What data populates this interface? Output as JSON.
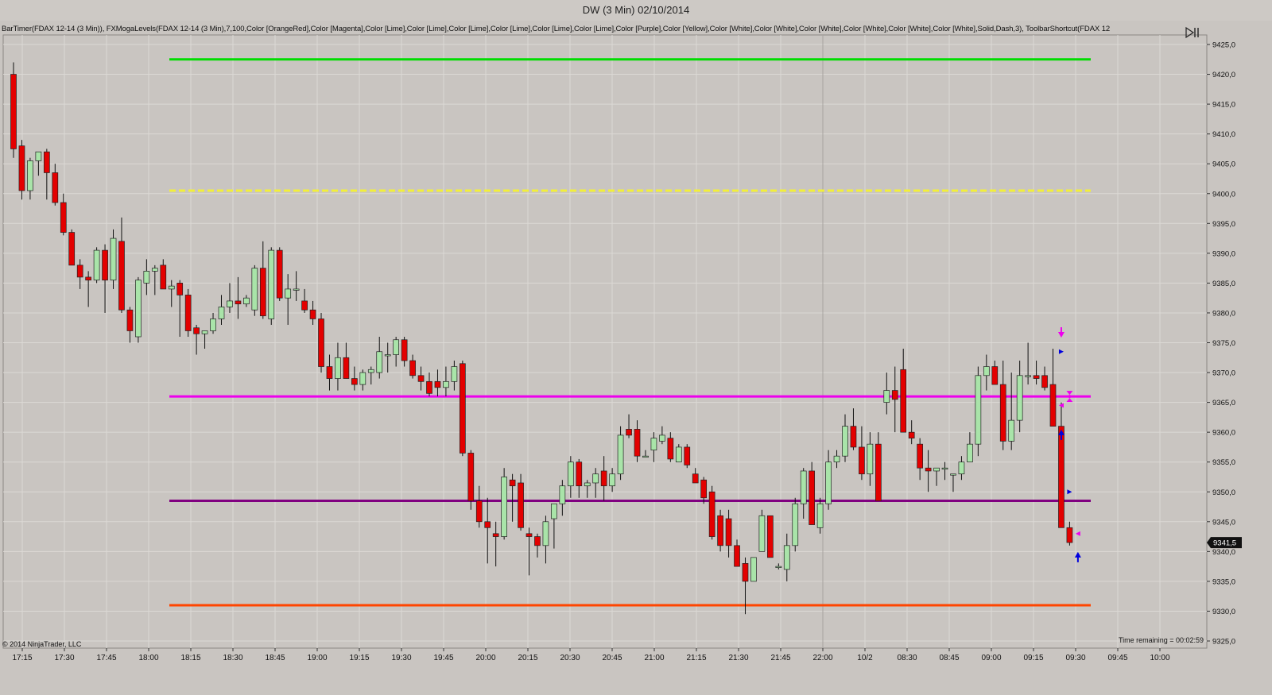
{
  "window": {
    "title": "DW (3 Min)  02/10/2014"
  },
  "indicator_text": "BarTimer(FDAX 12-14 (3 Min)), FXMogaLevels(FDAX 12-14 (3 Min),7,100,Color [OrangeRed],Color [Magenta],Color [Lime],Color [Lime],Color [Lime],Color [Lime],Color [Lime],Color [Lime],Color [Purple],Color [Yellow],Color [White],Color [White],Color [White],Color [White],Color [White],Color [White],Solid,Dash,3), ToolbarShortcut(FDAX 12",
  "copyright": "© 2014 NinjaTrader, LLC",
  "time_remaining": "Time remaining = 00:02:59",
  "colors": {
    "background": "#c9c5c1",
    "grid": "#dcd9d5",
    "up_candle": "#a9e4a9",
    "down_candle": "#e30000",
    "wick": "#111111"
  },
  "chart_data": {
    "type": "candlestick",
    "title": "DW (3 Min)  02/10/2014",
    "ylim": [
      9325,
      9428
    ],
    "grid": true,
    "y_ticks": [
      "9425,0",
      "9420,0",
      "9415,0",
      "9410,0",
      "9405,0",
      "9400,0",
      "9395,0",
      "9390,0",
      "9385,0",
      "9380,0",
      "9375,0",
      "9370,0",
      "9365,0",
      "9360,0",
      "9355,0",
      "9350,0",
      "9345,0",
      "9340,0",
      "9335,0",
      "9330,0",
      "9325,0"
    ],
    "x_ticks": [
      "17:15",
      "17:30",
      "17:45",
      "18:00",
      "18:15",
      "18:30",
      "18:45",
      "19:00",
      "19:15",
      "19:30",
      "19:45",
      "20:00",
      "20:15",
      "20:30",
      "20:45",
      "21:00",
      "21:15",
      "21:30",
      "21:45",
      "22:00",
      "10/2",
      "08:30",
      "08:45",
      "09:00",
      "09:15",
      "09:30",
      "09:45",
      "10:00"
    ],
    "last_price": "9341,5",
    "levels": [
      {
        "name": "lime-level",
        "value": 9422.5,
        "color": "#00dd00",
        "style": "solid"
      },
      {
        "name": "yellow-level",
        "value": 9400.5,
        "color": "#f2ef3a",
        "style": "dash"
      },
      {
        "name": "magenta-level",
        "value": 9366.0,
        "color": "#ee00ee",
        "style": "solid"
      },
      {
        "name": "purple-level",
        "value": 9348.5,
        "color": "#800080",
        "style": "solid"
      },
      {
        "name": "orangered-level",
        "value": 9331.0,
        "color": "#ff4500",
        "style": "solid"
      }
    ],
    "candles": [
      {
        "o": 9420,
        "h": 9422,
        "l": 9406,
        "c": 9407.5
      },
      {
        "o": 9408,
        "h": 9409,
        "l": 9399,
        "c": 9400.5
      },
      {
        "o": 9400.5,
        "h": 9406,
        "l": 9399,
        "c": 9405.5
      },
      {
        "o": 9405.5,
        "h": 9407,
        "l": 9403,
        "c": 9407
      },
      {
        "o": 9407,
        "h": 9407.5,
        "l": 9399,
        "c": 9403.5
      },
      {
        "o": 9403.5,
        "h": 9405,
        "l": 9398,
        "c": 9398.5
      },
      {
        "o": 9398.5,
        "h": 9400,
        "l": 9393,
        "c": 9393.5
      },
      {
        "o": 9393.5,
        "h": 9394,
        "l": 9388,
        "c": 9388
      },
      {
        "o": 9388,
        "h": 9389,
        "l": 9384,
        "c": 9386
      },
      {
        "o": 9386,
        "h": 9387,
        "l": 9381,
        "c": 9385.5
      },
      {
        "o": 9385.5,
        "h": 9391,
        "l": 9385,
        "c": 9390.5
      },
      {
        "o": 9390.5,
        "h": 9391.5,
        "l": 9380,
        "c": 9385.5
      },
      {
        "o": 9385.5,
        "h": 9394,
        "l": 9384,
        "c": 9392.5
      },
      {
        "o": 9392,
        "h": 9396,
        "l": 9380,
        "c": 9380.5
      },
      {
        "o": 9380.5,
        "h": 9381,
        "l": 9375,
        "c": 9377
      },
      {
        "o": 9376,
        "h": 9386,
        "l": 9375,
        "c": 9385.5
      },
      {
        "o": 9385,
        "h": 9389,
        "l": 9383,
        "c": 9387
      },
      {
        "o": 9387,
        "h": 9388,
        "l": 9383,
        "c": 9387.5
      },
      {
        "o": 9388,
        "h": 9389,
        "l": 9384,
        "c": 9384
      },
      {
        "o": 9384,
        "h": 9385.5,
        "l": 9381,
        "c": 9384.5
      },
      {
        "o": 9385,
        "h": 9385.5,
        "l": 9376,
        "c": 9383
      },
      {
        "o": 9383,
        "h": 9384,
        "l": 9376,
        "c": 9377
      },
      {
        "o": 9377.5,
        "h": 9378,
        "l": 9373,
        "c": 9376.5
      },
      {
        "o": 9376.5,
        "h": 9377,
        "l": 9374,
        "c": 9377
      },
      {
        "o": 9377,
        "h": 9380,
        "l": 9376.5,
        "c": 9379
      },
      {
        "o": 9379,
        "h": 9383,
        "l": 9378,
        "c": 9381
      },
      {
        "o": 9381,
        "h": 9385,
        "l": 9380,
        "c": 9382
      },
      {
        "o": 9382,
        "h": 9386,
        "l": 9379,
        "c": 9381.5
      },
      {
        "o": 9381.5,
        "h": 9383,
        "l": 9381,
        "c": 9382.5
      },
      {
        "o": 9380.5,
        "h": 9388,
        "l": 9379.5,
        "c": 9387.5
      },
      {
        "o": 9387.5,
        "h": 9392,
        "l": 9379,
        "c": 9379.5
      },
      {
        "o": 9379,
        "h": 9391,
        "l": 9378,
        "c": 9390.5
      },
      {
        "o": 9390.5,
        "h": 9391,
        "l": 9382,
        "c": 9382.5
      },
      {
        "o": 9382.5,
        "h": 9386.5,
        "l": 9378,
        "c": 9384
      },
      {
        "o": 9384,
        "h": 9387,
        "l": 9382,
        "c": 9384
      },
      {
        "o": 9382,
        "h": 9384,
        "l": 9380,
        "c": 9380.5
      },
      {
        "o": 9380.5,
        "h": 9382,
        "l": 9378,
        "c": 9379
      },
      {
        "o": 9379,
        "h": 9380,
        "l": 9370,
        "c": 9371
      },
      {
        "o": 9371,
        "h": 9373,
        "l": 9367,
        "c": 9369
      },
      {
        "o": 9369,
        "h": 9375,
        "l": 9367,
        "c": 9372.5
      },
      {
        "o": 9372.5,
        "h": 9375,
        "l": 9369,
        "c": 9369
      },
      {
        "o": 9369,
        "h": 9371,
        "l": 9367,
        "c": 9368
      },
      {
        "o": 9368,
        "h": 9370.5,
        "l": 9367,
        "c": 9370
      },
      {
        "o": 9370,
        "h": 9371,
        "l": 9368,
        "c": 9370.5
      },
      {
        "o": 9370,
        "h": 9376,
        "l": 9369,
        "c": 9373.5
      },
      {
        "o": 9373,
        "h": 9375,
        "l": 9370,
        "c": 9373
      },
      {
        "o": 9373,
        "h": 9376,
        "l": 9371,
        "c": 9375.5
      },
      {
        "o": 9375.5,
        "h": 9376,
        "l": 9371,
        "c": 9372
      },
      {
        "o": 9372,
        "h": 9373,
        "l": 9369,
        "c": 9369.5
      },
      {
        "o": 9369.5,
        "h": 9371,
        "l": 9367,
        "c": 9368.5
      },
      {
        "o": 9368.5,
        "h": 9370,
        "l": 9366,
        "c": 9366.5
      },
      {
        "o": 9368.5,
        "h": 9370.5,
        "l": 9366,
        "c": 9367.5
      },
      {
        "o": 9367.5,
        "h": 9371,
        "l": 9366,
        "c": 9368.5
      },
      {
        "o": 9368.5,
        "h": 9372,
        "l": 9367,
        "c": 9371
      },
      {
        "o": 9371.5,
        "h": 9372,
        "l": 9356,
        "c": 9356.5
      },
      {
        "o": 9356.5,
        "h": 9357,
        "l": 9347,
        "c": 9348.5
      },
      {
        "o": 9348.5,
        "h": 9351,
        "l": 9344,
        "c": 9345
      },
      {
        "o": 9345,
        "h": 9349,
        "l": 9338,
        "c": 9344
      },
      {
        "o": 9343,
        "h": 9345,
        "l": 9337.5,
        "c": 9342.5
      },
      {
        "o": 9342.5,
        "h": 9354,
        "l": 9342,
        "c": 9352.5
      },
      {
        "o": 9352,
        "h": 9353,
        "l": 9345,
        "c": 9351
      },
      {
        "o": 9351.5,
        "h": 9353,
        "l": 9343.5,
        "c": 9344
      },
      {
        "o": 9343,
        "h": 9344,
        "l": 9336,
        "c": 9342.5
      },
      {
        "o": 9342.5,
        "h": 9343,
        "l": 9339,
        "c": 9341
      },
      {
        "o": 9341,
        "h": 9346,
        "l": 9338,
        "c": 9345
      },
      {
        "o": 9345.5,
        "h": 9348,
        "l": 9340.5,
        "c": 9348
      },
      {
        "o": 9348,
        "h": 9352,
        "l": 9346,
        "c": 9351
      },
      {
        "o": 9351,
        "h": 9356,
        "l": 9349,
        "c": 9355
      },
      {
        "o": 9355,
        "h": 9355.5,
        "l": 9349,
        "c": 9351
      },
      {
        "o": 9351,
        "h": 9352,
        "l": 9349,
        "c": 9351.5
      },
      {
        "o": 9351.5,
        "h": 9354,
        "l": 9349,
        "c": 9353
      },
      {
        "o": 9353.5,
        "h": 9356,
        "l": 9348.5,
        "c": 9351
      },
      {
        "o": 9351,
        "h": 9354,
        "l": 9350,
        "c": 9353
      },
      {
        "o": 9353,
        "h": 9361,
        "l": 9352,
        "c": 9359.5
      },
      {
        "o": 9360.5,
        "h": 9363,
        "l": 9359,
        "c": 9359.5
      },
      {
        "o": 9360.5,
        "h": 9362,
        "l": 9355,
        "c": 9356
      },
      {
        "o": 9356,
        "h": 9357,
        "l": 9356,
        "c": 9356
      },
      {
        "o": 9357,
        "h": 9360,
        "l": 9355,
        "c": 9359
      },
      {
        "o": 9358.5,
        "h": 9361,
        "l": 9358,
        "c": 9359.5
      },
      {
        "o": 9359,
        "h": 9360,
        "l": 9355,
        "c": 9355.5
      },
      {
        "o": 9355,
        "h": 9358,
        "l": 9355,
        "c": 9357.5
      },
      {
        "o": 9357.5,
        "h": 9358,
        "l": 9354,
        "c": 9354.5
      },
      {
        "o": 9353,
        "h": 9354,
        "l": 9352,
        "c": 9351.5
      },
      {
        "o": 9352,
        "h": 9352.5,
        "l": 9348,
        "c": 9349
      },
      {
        "o": 9350,
        "h": 9351,
        "l": 9342,
        "c": 9342.5
      },
      {
        "o": 9346,
        "h": 9347,
        "l": 9340,
        "c": 9341
      },
      {
        "o": 9345.5,
        "h": 9347,
        "l": 9339,
        "c": 9341
      },
      {
        "o": 9341,
        "h": 9342,
        "l": 9338,
        "c": 9337.5
      },
      {
        "o": 9338,
        "h": 9339,
        "l": 9329.5,
        "c": 9335
      },
      {
        "o": 9335,
        "h": 9339,
        "l": 9335,
        "c": 9339
      },
      {
        "o": 9340,
        "h": 9347,
        "l": 9340,
        "c": 9346
      },
      {
        "o": 9346,
        "h": 9346,
        "l": 9339,
        "c": 9339
      },
      {
        "o": 9337.5,
        "h": 9338,
        "l": 9337,
        "c": 9337.5
      },
      {
        "o": 9337,
        "h": 9343,
        "l": 9335,
        "c": 9341
      },
      {
        "o": 9341,
        "h": 9349,
        "l": 9340,
        "c": 9348
      },
      {
        "o": 9348,
        "h": 9354,
        "l": 9345.5,
        "c": 9353.5
      },
      {
        "o": 9353.5,
        "h": 9355,
        "l": 9348,
        "c": 9344.5
      },
      {
        "o": 9344,
        "h": 9349,
        "l": 9343,
        "c": 9348
      },
      {
        "o": 9348,
        "h": 9357,
        "l": 9347,
        "c": 9355
      },
      {
        "o": 9355,
        "h": 9357,
        "l": 9354,
        "c": 9356
      },
      {
        "o": 9356,
        "h": 9363,
        "l": 9355,
        "c": 9361
      },
      {
        "o": 9361,
        "h": 9364,
        "l": 9357,
        "c": 9357.5
      },
      {
        "o": 9357.5,
        "h": 9361,
        "l": 9352,
        "c": 9353
      },
      {
        "o": 9353,
        "h": 9360,
        "l": 9351,
        "c": 9358
      },
      {
        "o": 9358,
        "h": 9360,
        "l": 9348.5,
        "c": 9348.5
      },
      {
        "o": 9365,
        "h": 9370,
        "l": 9363,
        "c": 9367
      },
      {
        "o": 9367,
        "h": 9371,
        "l": 9360,
        "c": 9365.5
      },
      {
        "o": 9370.5,
        "h": 9374,
        "l": 9360,
        "c": 9360
      },
      {
        "o": 9360,
        "h": 9362,
        "l": 9358,
        "c": 9359
      },
      {
        "o": 9358,
        "h": 9359,
        "l": 9352,
        "c": 9354
      },
      {
        "o": 9354,
        "h": 9357,
        "l": 9350,
        "c": 9353.5
      },
      {
        "o": 9353.5,
        "h": 9354,
        "l": 9351,
        "c": 9354
      },
      {
        "o": 9354,
        "h": 9355,
        "l": 9352,
        "c": 9354
      },
      {
        "o": 9353,
        "h": 9353,
        "l": 9350,
        "c": 9353
      },
      {
        "o": 9353,
        "h": 9356,
        "l": 9352,
        "c": 9355
      },
      {
        "o": 9355,
        "h": 9360,
        "l": 9355,
        "c": 9358
      },
      {
        "o": 9358,
        "h": 9371,
        "l": 9356,
        "c": 9369.5
      },
      {
        "o": 9369.5,
        "h": 9373,
        "l": 9367,
        "c": 9371
      },
      {
        "o": 9371,
        "h": 9372,
        "l": 9368,
        "c": 9368
      },
      {
        "o": 9368,
        "h": 9372,
        "l": 9357,
        "c": 9358.5
      },
      {
        "o": 9358.5,
        "h": 9370,
        "l": 9357,
        "c": 9362
      },
      {
        "o": 9362,
        "h": 9372,
        "l": 9360,
        "c": 9369.5
      },
      {
        "o": 9369.5,
        "h": 9375,
        "l": 9368,
        "c": 9369.5
      },
      {
        "o": 9369.5,
        "h": 9372,
        "l": 9368,
        "c": 9369
      },
      {
        "o": 9369.5,
        "h": 9371,
        "l": 9367,
        "c": 9367.5
      },
      {
        "o": 9368,
        "h": 9374,
        "l": 9361,
        "c": 9361
      },
      {
        "o": 9361,
        "h": 9365,
        "l": 9345,
        "c": 9344
      },
      {
        "o": 9344,
        "h": 9345,
        "l": 9341,
        "c": 9341.5
      }
    ],
    "signals": [
      {
        "index": 126,
        "price": 9376.0,
        "kind": "magenta-down"
      },
      {
        "index": 126,
        "price": 9373.5,
        "kind": "blue-marker"
      },
      {
        "index": 126,
        "price": 9364.5,
        "kind": "magenta-mark"
      },
      {
        "index": 127,
        "price": 9366.0,
        "kind": "magenta-double"
      },
      {
        "index": 126,
        "price": 9359.5,
        "kind": "blue-up"
      },
      {
        "index": 127,
        "price": 9350.0,
        "kind": "blue-marker"
      },
      {
        "index": 128,
        "price": 9343.0,
        "kind": "magenta-mark"
      },
      {
        "index": 128,
        "price": 9339.0,
        "kind": "blue-up"
      }
    ]
  }
}
